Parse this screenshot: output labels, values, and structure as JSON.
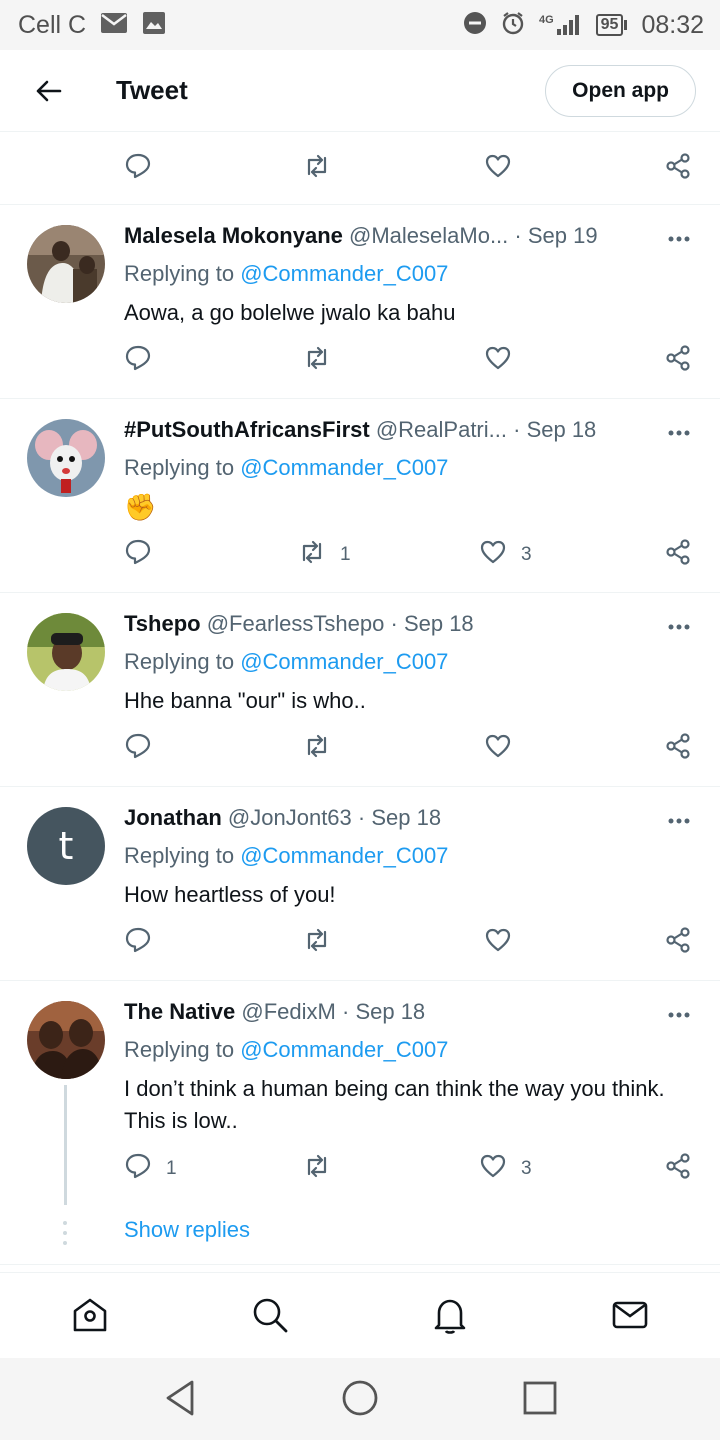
{
  "status_bar": {
    "carrier": "Cell C",
    "battery": "95",
    "network": "4G",
    "time": "08:32",
    "icons": [
      "mail-icon",
      "image-icon",
      "dnd-icon",
      "alarm-icon",
      "signal-icon",
      "battery-icon"
    ]
  },
  "header": {
    "title": "Tweet",
    "open_app": "Open app"
  },
  "tweets": [
    {
      "name": "Malesela Mokonyane",
      "handle": "@MaleselaMo...",
      "date": "Sep 19",
      "replying_prefix": "Replying to",
      "replying_to": "@Commander_C007",
      "text": "Aowa, a go bolelwe jwalo ka bahu",
      "retweets": "",
      "likes": "",
      "replies": ""
    },
    {
      "name": "#PutSouthAfricansFirst",
      "handle": "@RealPatri...",
      "date": "Sep 18",
      "replying_prefix": "Replying to",
      "replying_to": "@Commander_C007",
      "text": "✊",
      "retweets": "1",
      "likes": "3",
      "replies": ""
    },
    {
      "name": "Tshepo",
      "handle": "@FearlessTshepo",
      "date": "Sep 18",
      "replying_prefix": "Replying to",
      "replying_to": "@Commander_C007",
      "text": "Hhe banna \"our\" is who..",
      "retweets": "",
      "likes": "",
      "replies": ""
    },
    {
      "name": "Jonathan",
      "handle": "@JonJont63",
      "date": "Sep 18",
      "replying_prefix": "Replying to",
      "replying_to": "@Commander_C007",
      "text": "How heartless of you!",
      "avatar_letter": "t",
      "retweets": "",
      "likes": "",
      "replies": ""
    },
    {
      "name": "The Native",
      "handle": "@FedixM",
      "date": "Sep 18",
      "replying_prefix": "Replying to",
      "replying_to": "@Commander_C007",
      "text": "I don’t think a human being can think the way you think. This is low..",
      "retweets": "",
      "likes": "3",
      "replies": "1"
    }
  ],
  "show_replies": "Show replies",
  "dot_sep": "·",
  "colors": {
    "accent": "#1d9bf0",
    "secondary_text": "#536471",
    "border": "#eff3f4"
  },
  "bottom_nav": [
    "home-icon",
    "search-icon",
    "notifications-icon",
    "messages-icon"
  ],
  "system_nav": [
    "back-triangle-icon",
    "home-circle-icon",
    "recents-square-icon"
  ]
}
